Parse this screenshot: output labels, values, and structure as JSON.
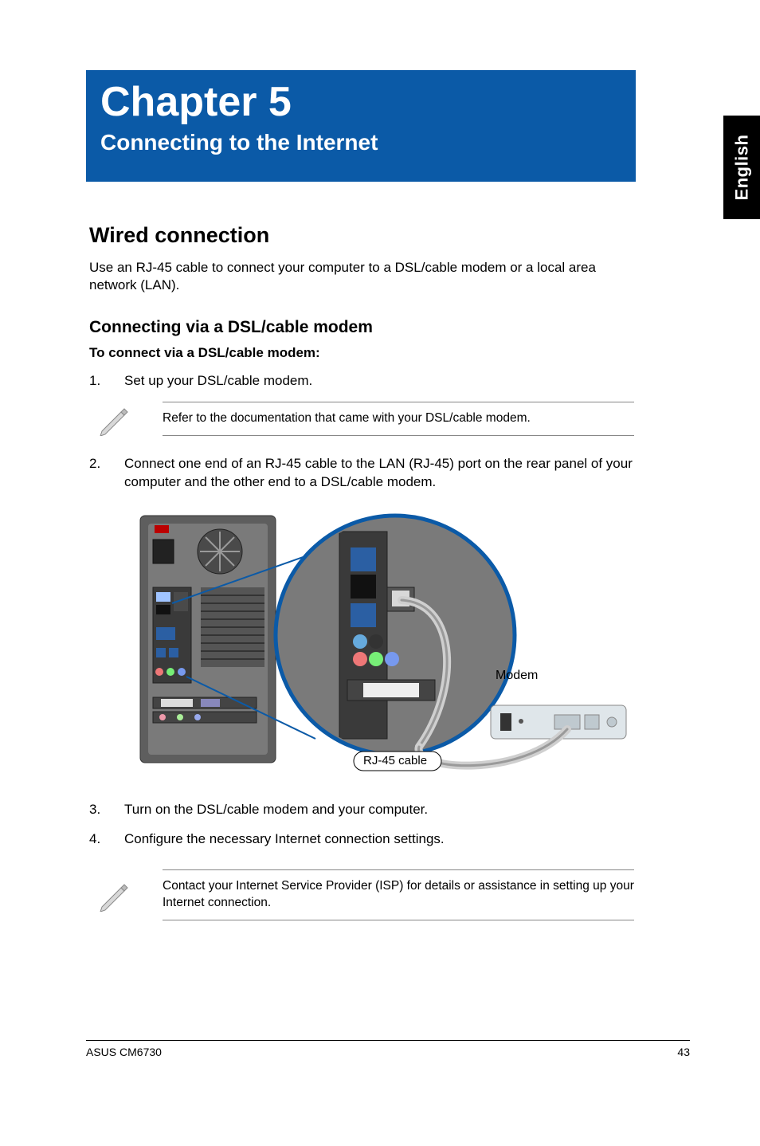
{
  "lang_tab": "English",
  "banner": {
    "chapter": "Chapter 5",
    "title": "Connecting to the Internet"
  },
  "section": {
    "title": "Wired connection",
    "intro": "Use an RJ-45 cable to connect your computer to a DSL/cable modem or a local area network (LAN)."
  },
  "subsection": {
    "title": "Connecting via a DSL/cable modem",
    "lead": "To connect via a DSL/cable modem:"
  },
  "steps": {
    "s1_num": "1.",
    "s1_text": "Set up your DSL/cable modem.",
    "note1": "Refer to the documentation that came with your DSL/cable modem.",
    "s2_num": "2.",
    "s2_text": "Connect one end of an RJ-45 cable to the LAN (RJ-45) port on the rear panel of your computer and the other end to a DSL/cable modem.",
    "s3_num": "3.",
    "s3_text": "Turn on the DSL/cable modem and your computer.",
    "s4_num": "4.",
    "s4_text": "Configure the necessary Internet connection settings.",
    "note2": "Contact your Internet Service Provider (ISP) for details or assistance in setting up your Internet connection."
  },
  "diagram": {
    "modem_label": "Modem",
    "cable_label": "RJ-45 cable"
  },
  "footer": {
    "left": "ASUS CM6730",
    "right": "43"
  }
}
